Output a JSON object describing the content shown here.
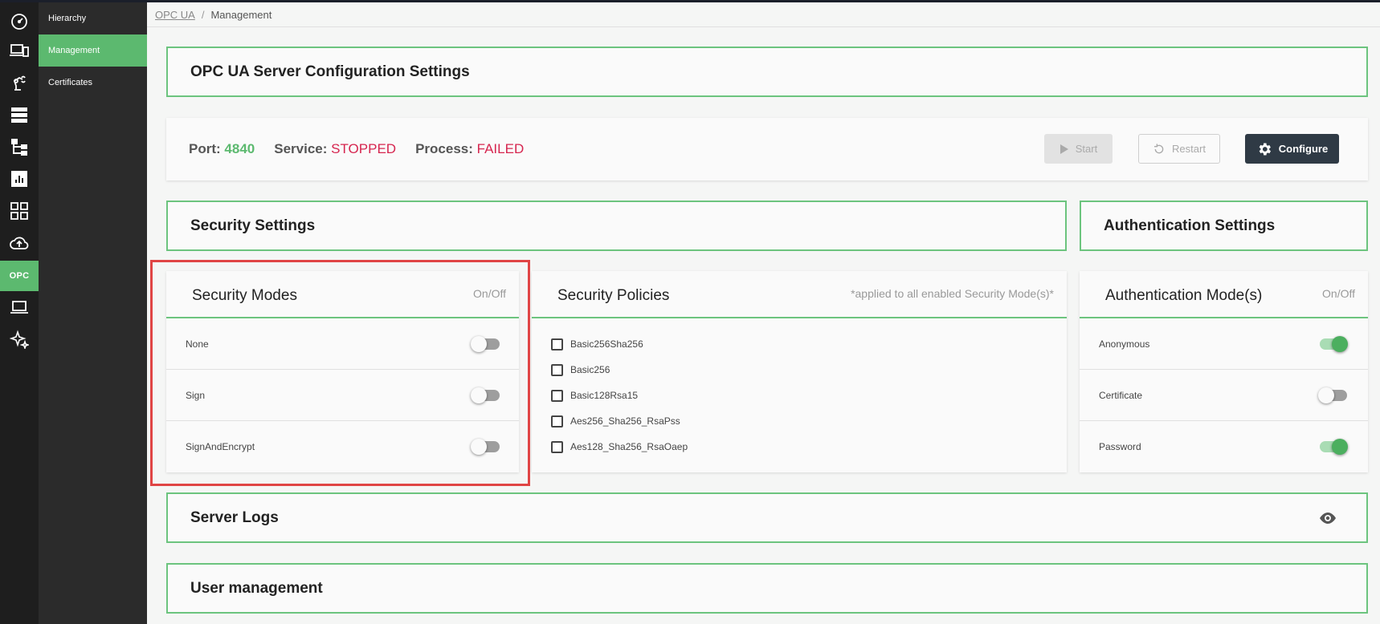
{
  "rail": {
    "items": [
      {
        "icon": "dashboard-icon"
      },
      {
        "icon": "devices-icon"
      },
      {
        "icon": "robot-arm-icon"
      },
      {
        "icon": "server-icon"
      },
      {
        "icon": "hierarchy-icon"
      },
      {
        "icon": "report-icon"
      },
      {
        "icon": "grid-icon"
      },
      {
        "icon": "cloud-upload-icon"
      },
      {
        "label": "OPC",
        "active": true
      },
      {
        "icon": "laptop-icon"
      },
      {
        "icon": "sparkles-icon"
      }
    ]
  },
  "subnav": {
    "items": [
      {
        "label": "Hierarchy"
      },
      {
        "label": "Management",
        "active": true
      },
      {
        "label": "Certificates"
      }
    ]
  },
  "breadcrumb": {
    "root": "OPC UA",
    "separator": "/",
    "current": "Management"
  },
  "server_config": {
    "title": "OPC UA Server Configuration Settings"
  },
  "status": {
    "port_label": "Port:",
    "port_value": "4840",
    "service_label": "Service:",
    "service_value": "STOPPED",
    "process_label": "Process:",
    "process_value": "FAILED",
    "start_label": "Start",
    "restart_label": "Restart",
    "configure_label": "Configure"
  },
  "security_settings": {
    "title": "Security Settings"
  },
  "authentication_settings": {
    "title": "Authentication Settings"
  },
  "security_modes": {
    "title": "Security Modes",
    "hint": "On/Off",
    "items": [
      {
        "label": "None",
        "enabled": false
      },
      {
        "label": "Sign",
        "enabled": false
      },
      {
        "label": "SignAndEncrypt",
        "enabled": false
      }
    ]
  },
  "security_policies": {
    "title": "Security Policies",
    "hint": "*applied to all enabled Security Mode(s)*",
    "items": [
      {
        "label": "Basic256Sha256",
        "checked": false
      },
      {
        "label": "Basic256",
        "checked": false
      },
      {
        "label": "Basic128Rsa15",
        "checked": false
      },
      {
        "label": "Aes256_Sha256_RsaPss",
        "checked": false
      },
      {
        "label": "Aes128_Sha256_RsaOaep",
        "checked": false
      }
    ]
  },
  "authentication_modes": {
    "title": "Authentication Mode(s)",
    "hint": "On/Off",
    "items": [
      {
        "label": "Anonymous",
        "enabled": true
      },
      {
        "label": "Certificate",
        "enabled": false
      },
      {
        "label": "Password",
        "enabled": true
      }
    ]
  },
  "server_logs": {
    "title": "Server Logs",
    "icon": "eye-icon"
  },
  "user_management": {
    "title": "User management"
  },
  "colors": {
    "accent": "#5cb96f",
    "error": "#d6254f",
    "highlight": "#e04545",
    "dark": "#2f3a45"
  }
}
